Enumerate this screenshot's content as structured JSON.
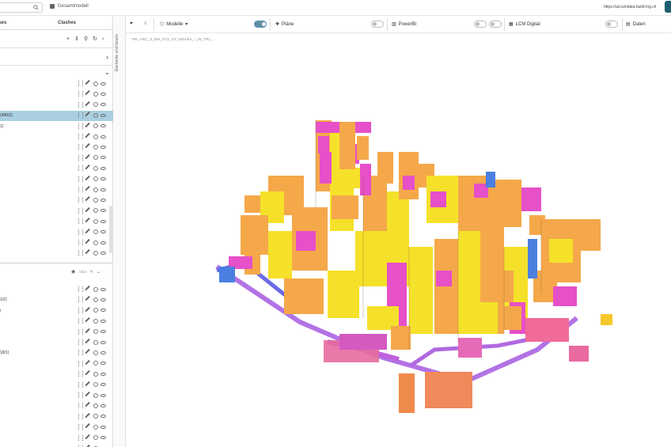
{
  "topbar": {
    "model_name": "Gesamtmodell",
    "url": "https://accumdata.build-log.ch"
  },
  "left_panel": {
    "tab_issues": "ues",
    "tab_clashes": "Clashes",
    "tools": [
      "+",
      "⇕",
      "⚲",
      "↻",
      "›"
    ],
    "section1_rows": [
      {
        "label": "",
        "selected": false
      },
      {
        "label": "",
        "selected": false
      },
      {
        "label": "",
        "selected": false
      },
      {
        "label": "(496/2)",
        "selected": true
      },
      {
        "label": "1)",
        "selected": false
      },
      {
        "label": "",
        "selected": false
      },
      {
        "label": "",
        "selected": false
      },
      {
        "label": "",
        "selected": false
      },
      {
        "label": "",
        "selected": false
      },
      {
        "label": "",
        "selected": false
      },
      {
        "label": "",
        "selected": false
      },
      {
        "label": "",
        "selected": false
      },
      {
        "label": "",
        "selected": false
      },
      {
        "label": "",
        "selected": false
      },
      {
        "label": "",
        "selected": false
      },
      {
        "label": "",
        "selected": false
      },
      {
        "label": "",
        "selected": false
      }
    ],
    "section2_count": "0/14",
    "section2_rows": [
      {
        "label": ""
      },
      {
        "label": "1/2)"
      },
      {
        "label": "i"
      },
      {
        "label": ""
      },
      {
        "label": ""
      },
      {
        "label": ""
      },
      {
        "label": "18/1)"
      },
      {
        "label": ""
      },
      {
        "label": ""
      },
      {
        "label": ""
      },
      {
        "label": ""
      },
      {
        "label": ""
      },
      {
        "label": ""
      },
      {
        "label": ""
      },
      {
        "label": ""
      },
      {
        "label": ""
      },
      {
        "label": ""
      }
    ]
  },
  "sidebar_handle_label": "Elemente und Issues",
  "toolbar": {
    "models_label": "Modelle",
    "plans_label": "Pläne",
    "powerbi_label": "PowerBI",
    "lcm_label": "LCM Digital",
    "data_label": "Daten",
    "models_toggle_on": true,
    "plans_toggle_on": false,
    "powerbi_toggle_on": false,
    "lcm_toggle_on": false
  },
  "breadcrumb": "TRI_ARC_3_BM_XXX_XX_MOLBA_-_IN_TRI_...",
  "colors": {
    "yellow": "#f5e12a",
    "orange": "#f5a84a",
    "magenta": "#e650c8",
    "pink": "#f06a9a",
    "violet": "#a55ae0",
    "blue": "#4a7fe0",
    "accent": "#5f8fa6"
  }
}
